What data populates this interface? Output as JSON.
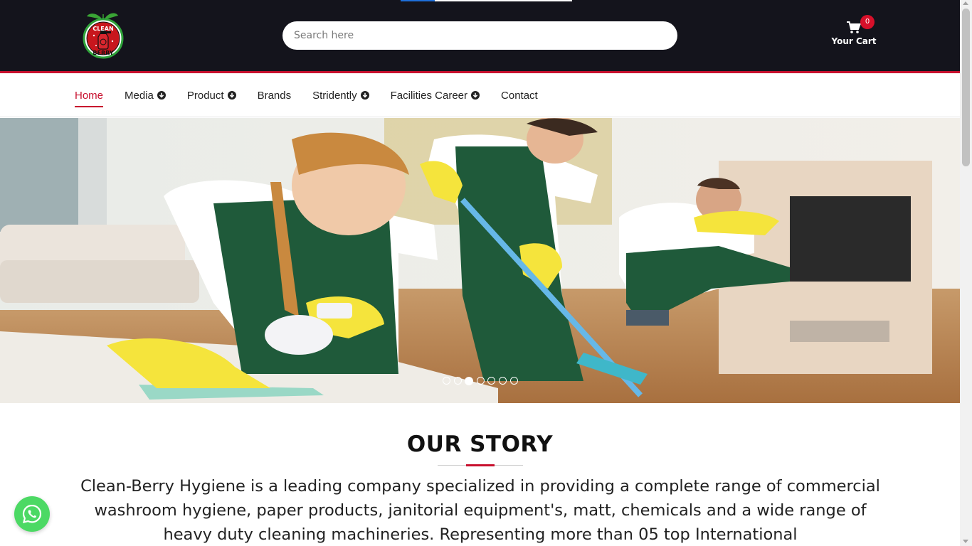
{
  "colors": {
    "header_bg": "#14141c",
    "accent_red": "#c8102e",
    "whatsapp_green": "#4cd964",
    "badge_red": "#d7102a"
  },
  "loading_progress": 0.2,
  "brand": {
    "logo_top": "CLEAN",
    "logo_bottom": "BERRY",
    "logo_icon": "clean-berry-logo-icon"
  },
  "search": {
    "placeholder": "Search here",
    "value": ""
  },
  "cart": {
    "icon": "cart-icon",
    "count": "0",
    "label": "Your Cart"
  },
  "nav": {
    "items": [
      {
        "label": "Home",
        "active": true,
        "dropdown": false
      },
      {
        "label": "Media",
        "active": false,
        "dropdown": true
      },
      {
        "label": "Product",
        "active": false,
        "dropdown": true
      },
      {
        "label": "Brands",
        "active": false,
        "dropdown": false
      },
      {
        "label": "Stridently",
        "active": false,
        "dropdown": true
      },
      {
        "label": "Facilities Career",
        "active": false,
        "dropdown": true
      },
      {
        "label": "Contact",
        "active": false,
        "dropdown": false
      }
    ],
    "dropdown_icon": "circle-arrow-down-icon"
  },
  "hero": {
    "image": "cleaning-staff-banner-image",
    "slide_count": 7,
    "active_slide": 3
  },
  "story": {
    "title": "OUR STORY",
    "text": "Clean-Berry Hygiene is a leading company specialized in providing a complete range of commercial washroom hygiene, paper products, janitorial equipment's, matt, chemicals and a wide range of heavy duty cleaning machineries. Representing more than 05 top International"
  },
  "whatsapp": {
    "icon": "whatsapp-icon"
  }
}
